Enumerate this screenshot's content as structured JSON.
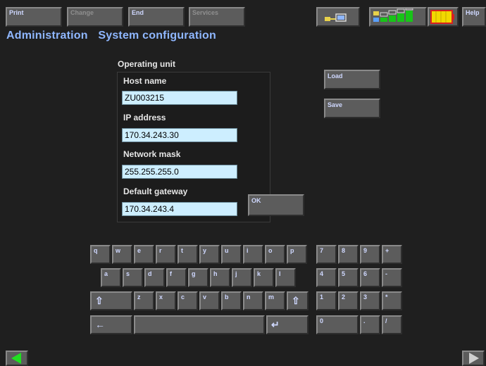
{
  "toolbar": {
    "print": "Print",
    "change": "Change",
    "end": "End",
    "services": "Services",
    "help": "Help"
  },
  "breadcrumb": {
    "area": "Administration",
    "page": "System configuration"
  },
  "form": {
    "section_title": "Operating unit",
    "host_label": "Host name",
    "host_value": "ZU003215",
    "ip_label": "IP address",
    "ip_value": "170.34.243.30",
    "mask_label": "Network mask",
    "mask_value": "255.255.255.0",
    "gateway_label": "Default gateway",
    "gateway_value": "170.34.243.4",
    "ok": "OK",
    "load": "Load",
    "save": "Save"
  },
  "keyboard": {
    "row1": [
      "q",
      "w",
      "e",
      "r",
      "t",
      "y",
      "u",
      "i",
      "o",
      "p"
    ],
    "row2": [
      "a",
      "s",
      "d",
      "f",
      "g",
      "h",
      "j",
      "k",
      "l"
    ],
    "row3": [
      "z",
      "x",
      "c",
      "v",
      "b",
      "n",
      "m"
    ],
    "shift": "⇧",
    "backspace": "←",
    "enter": "↵"
  },
  "numpad": {
    "r1": [
      "7",
      "8",
      "9",
      "+"
    ],
    "r2": [
      "4",
      "5",
      "6",
      "-"
    ],
    "r3": [
      "1",
      "2",
      "3",
      "*"
    ],
    "r4": [
      "0",
      "",
      ".",
      "/"
    ]
  },
  "colors": {
    "accent": "#8fb7ff",
    "field_bg": "#cdeeff",
    "button": "#5c5c5c"
  }
}
